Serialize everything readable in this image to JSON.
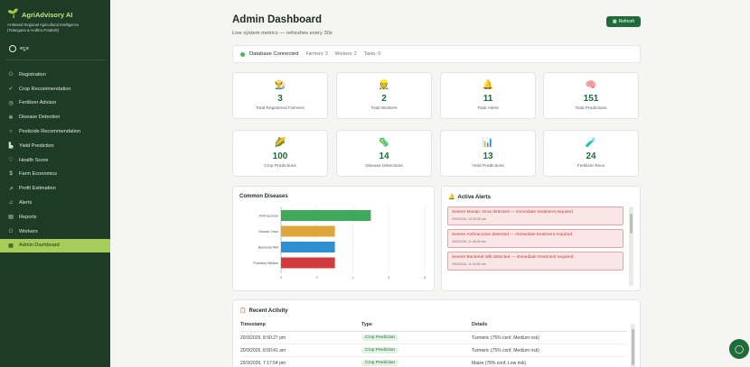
{
  "brand": {
    "name": "AgriAdvisory AI",
    "subtitle_line1": "AI-Based Regional Agricultural Intelligence",
    "subtitle_line2": "(Telangana & Andhra Pradesh)"
  },
  "language": {
    "selected": "ಕನ್ನಡ"
  },
  "nav": [
    {
      "label": "Registration",
      "icon": "user-plus-icon",
      "glyph": "⚇"
    },
    {
      "label": "Crop Recommendation",
      "icon": "sprout-icon",
      "glyph": "✓"
    },
    {
      "label": "Fertilizer Advisor",
      "icon": "flask-icon",
      "glyph": "◷"
    },
    {
      "label": "Disease Detection",
      "icon": "bug-icon",
      "glyph": "✲"
    },
    {
      "label": "Pesticide Recommendation",
      "icon": "shield-icon",
      "glyph": "○"
    },
    {
      "label": "Yield Prediction",
      "icon": "bar-chart-icon",
      "glyph": "▙"
    },
    {
      "label": "Health Score",
      "icon": "heart-icon",
      "glyph": "♡"
    },
    {
      "label": "Farm Economics",
      "icon": "dollar-icon",
      "glyph": "$"
    },
    {
      "label": "Profit Estimation",
      "icon": "trend-up-icon",
      "glyph": "↗"
    },
    {
      "label": "Alerts",
      "icon": "bell-icon",
      "glyph": "♫"
    },
    {
      "label": "Reports",
      "icon": "file-icon",
      "glyph": "▤"
    },
    {
      "label": "Workers",
      "icon": "users-icon",
      "glyph": "⚇"
    },
    {
      "label": "Admin Dashboard",
      "icon": "dashboard-icon",
      "glyph": "▦",
      "active": true
    }
  ],
  "header": {
    "title": "Admin Dashboard",
    "subtitle": "Live system metrics — refreshes every 30s",
    "refresh_label": "Refresh"
  },
  "connection": {
    "status": "Database Connected",
    "farmers": "Farmers: 3",
    "workers": "Workers: 2",
    "tasks": "Tasks: 0",
    "status_color": "#3fb75f"
  },
  "stats": [
    {
      "value": "3",
      "label": "Total Registered Farmers",
      "icon": "farmer-icon",
      "glyph": "👨‍🌾"
    },
    {
      "value": "2",
      "label": "Total Workers",
      "icon": "worker-icon",
      "glyph": "👷"
    },
    {
      "value": "11",
      "label": "Total Alerts",
      "icon": "bell-icon",
      "glyph": "🔔"
    },
    {
      "value": "151",
      "label": "Total Predictions",
      "icon": "brain-icon",
      "glyph": "🧠"
    },
    {
      "value": "100",
      "label": "Crop Predictions",
      "icon": "corn-icon",
      "glyph": "🌽"
    },
    {
      "value": "14",
      "label": "Disease Detections",
      "icon": "microbe-icon",
      "glyph": "🦠"
    },
    {
      "value": "13",
      "label": "Yield Predictions",
      "icon": "chart-icon",
      "glyph": "📊"
    },
    {
      "value": "24",
      "label": "Fertilizer Recs",
      "icon": "syringe-icon",
      "glyph": "🧪"
    }
  ],
  "diseases_panel": {
    "title": "Common Diseases"
  },
  "chart_data": {
    "type": "bar",
    "orientation": "horizontal",
    "categories": [
      "Anthracnose",
      "Mosaic Virus",
      "Bacterial Wilt",
      "Powdery Mildew"
    ],
    "values": [
      5,
      3,
      3,
      3
    ],
    "colors": [
      "#3fa85a",
      "#e0a53a",
      "#2f8fd0",
      "#d23b3b"
    ],
    "xlim": [
      0,
      8
    ],
    "xticks": [
      "0",
      "2",
      "4",
      "6",
      "8"
    ],
    "grid": true
  },
  "alerts_panel": {
    "title": "Active Alerts",
    "items": [
      {
        "text": "Severe Mosaic Virus detected — immediate treatment required",
        "date": "20/3/2026, 10:53:08 am"
      },
      {
        "text": "Severe Anthracnose detected — immediate treatment required",
        "date": "19/3/2026, 11:48:09 am"
      },
      {
        "text": "Severe Bacterial Wilt detected — immediate treatment required",
        "date": "19/3/2026, 11:44:52 am"
      }
    ]
  },
  "activity": {
    "title": "Recent Activity",
    "columns": [
      "Timestamp",
      "Type",
      "Details"
    ],
    "rows": [
      {
        "timestamp": "20/3/2026, 8:50:27 pm",
        "type": "Crop Prediction",
        "details": "Turmeric (75% conf, Medium risk)"
      },
      {
        "timestamp": "20/3/2026, 8:50:41 am",
        "type": "Crop Prediction",
        "details": "Turmeric (75% conf, Medium risk)"
      },
      {
        "timestamp": "20/3/2026, 7:17:54 pm",
        "type": "Crop Prediction",
        "details": "Maize (78% conf, Low risk)"
      }
    ]
  },
  "colors": {
    "sidebar_bg": "#1e3b26",
    "active_nav": "#a6cc5a",
    "accent_green": "#1f6b3a",
    "alert_red": "#c0393b"
  }
}
